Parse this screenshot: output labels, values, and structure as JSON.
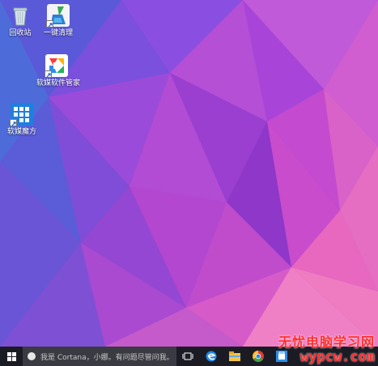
{
  "desktop": {
    "icons": [
      {
        "label": "回收站",
        "icon": "recycle-bin-icon"
      },
      {
        "label": "一键清理",
        "icon": "broom-cleanup-icon"
      },
      {
        "label": "软媒软件管家",
        "icon": "software-manager-icon"
      },
      {
        "label": "软媒魔方",
        "icon": "rubik-cube-icon"
      }
    ]
  },
  "taskbar": {
    "start_icon": "windows-logo-icon",
    "search_placeholder": "我是 Cortana，小娜。有问题尽管问我。",
    "pinned": [
      {
        "icon": "task-view-icon"
      },
      {
        "icon": "edge-browser-icon"
      },
      {
        "icon": "file-explorer-icon"
      },
      {
        "icon": "chrome-icon"
      },
      {
        "icon": "store-icon"
      }
    ]
  },
  "watermark": {
    "line1": "无忧电脑学习网",
    "line2": "wypcw.com"
  },
  "colors": {
    "taskbar": "#1b1b24",
    "wallpaper_primary": "#a24bd6",
    "wallpaper_secondary": "#e066c8"
  }
}
